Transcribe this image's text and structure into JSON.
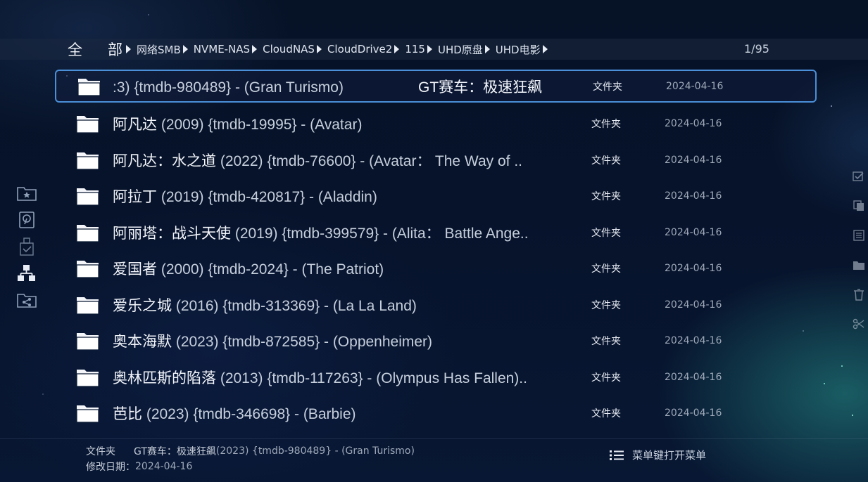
{
  "breadcrumb": {
    "root_chars": [
      "全",
      "部"
    ],
    "items": [
      "网络SMB",
      "NVME-NAS",
      "CloudNAS",
      "CloudDrive2",
      "115",
      "UHD原盘",
      "UHD电影"
    ],
    "page_counter": "1/95"
  },
  "left_icons": [
    "favorites-folder-icon",
    "local-disk-icon",
    "usb-drive-icon",
    "network-icon",
    "shared-folder-icon"
  ],
  "right_icons": [
    "select-icon",
    "copy-icon",
    "details-icon",
    "move-icon",
    "delete-icon",
    "cut-icon"
  ],
  "files": [
    {
      "cn": "",
      "en": ":3) {tmdb-980489} - (Gran Turismo)",
      "cn_tail": "GT赛车：极速狂飙",
      "type": "文件夹",
      "date": "2024-04-16"
    },
    {
      "cn": "阿凡达",
      "en": " (2009) {tmdb-19995} - (Avatar)",
      "cn_tail": "",
      "type": "文件夹",
      "date": "2024-04-16"
    },
    {
      "cn": "阿凡达：水之道",
      "en": " (2022) {tmdb-76600} - (Avatar：  The Way of ..",
      "cn_tail": "",
      "type": "文件夹",
      "date": "2024-04-16"
    },
    {
      "cn": "阿拉丁",
      "en": " (2019) {tmdb-420817} - (Aladdin)",
      "cn_tail": "",
      "type": "文件夹",
      "date": "2024-04-16"
    },
    {
      "cn": "阿丽塔：战斗天使",
      "en": " (2019) {tmdb-399579} - (Alita：  Battle Ange..",
      "cn_tail": "",
      "type": "文件夹",
      "date": "2024-04-16"
    },
    {
      "cn": "爱国者",
      "en": " (2000) {tmdb-2024} - (The Patriot)",
      "cn_tail": "",
      "type": "文件夹",
      "date": "2024-04-16"
    },
    {
      "cn": "爱乐之城",
      "en": " (2016) {tmdb-313369} - (La La Land)",
      "cn_tail": "",
      "type": "文件夹",
      "date": "2024-04-16"
    },
    {
      "cn": "奥本海默",
      "en": " (2023) {tmdb-872585} - (Oppenheimer)",
      "cn_tail": "",
      "type": "文件夹",
      "date": "2024-04-16"
    },
    {
      "cn": "奥林匹斯的陷落",
      "en": " (2013) {tmdb-117263} - (Olympus Has Fallen)..",
      "cn_tail": "",
      "type": "文件夹",
      "date": "2024-04-16"
    },
    {
      "cn": "芭比",
      "en": " (2023) {tmdb-346698} - (Barbie)",
      "cn_tail": "",
      "type": "文件夹",
      "date": "2024-04-16"
    }
  ],
  "info": {
    "type_label": "文件夹",
    "name_cn": "GT赛车：极速狂飙",
    "name_rest": " (2023) {tmdb-980489} - (Gran Turismo)",
    "date_label": "修改日期：",
    "date_value": "2024-04-16"
  },
  "menu_hint": "菜单键打开菜单",
  "colors": {
    "selection_border": "#4a8fd8",
    "background": "#07132b"
  }
}
